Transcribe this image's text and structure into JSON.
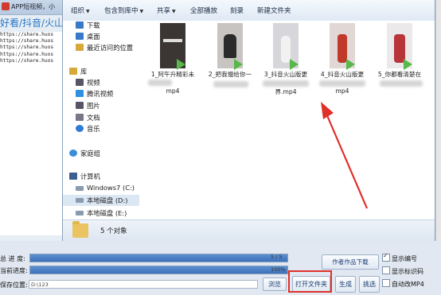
{
  "app": {
    "title": "APP短视频，小",
    "tab_label": "好看/抖音/火山",
    "urls": [
      "https://share.huos",
      "https://share.huos",
      "https://share.huos",
      "https://share.huos",
      "https://share.huos"
    ]
  },
  "explorer": {
    "toolbar": [
      {
        "label": "组织",
        "arrow": "▼"
      },
      {
        "label": "包含到库中",
        "arrow": "▼"
      },
      {
        "label": "共享",
        "arrow": "▼"
      },
      {
        "label": "全部播放",
        "arrow": ""
      },
      {
        "label": "刻录",
        "arrow": ""
      },
      {
        "label": "新建文件夹",
        "arrow": ""
      }
    ],
    "nav": [
      {
        "label": "下载",
        "icon": "download-folder-icon",
        "color": "#3a78c8"
      },
      {
        "label": "桌面",
        "icon": "desktop-icon",
        "color": "#3a78c8"
      },
      {
        "label": "最近访问的位置",
        "icon": "recent-places-icon",
        "color": "#d9a83a"
      },
      {
        "label": "库",
        "icon": "library-icon",
        "color": "#d9a83a"
      },
      {
        "label": "视频",
        "icon": "video-library-icon",
        "color": "#556"
      },
      {
        "label": "腾讯视频",
        "icon": "tencent-video-icon",
        "color": "#2f8fe0"
      },
      {
        "label": "图片",
        "icon": "pictures-library-icon",
        "color": "#556"
      },
      {
        "label": "文档",
        "icon": "documents-library-icon",
        "color": "#778"
      },
      {
        "label": "音乐",
        "icon": "music-library-icon",
        "color": "#2e7bd6"
      },
      {
        "label": "家庭组",
        "icon": "homegroup-icon",
        "color": "#3a8fd9"
      },
      {
        "label": "计算机",
        "icon": "computer-icon",
        "color": "#3b5f8f"
      },
      {
        "label": "Windows7 (C:)",
        "icon": "drive-c-icon",
        "color": "#8a9ab0"
      },
      {
        "label": "本地磁盘 (D:)",
        "icon": "drive-d-icon",
        "color": "#8a9ab0"
      },
      {
        "label": "本地磁盘 (E:)",
        "icon": "drive-e-icon",
        "color": "#8a9ab0"
      }
    ],
    "files": [
      {
        "name": "1_阿午升精彩未",
        "ext": "mp4",
        "bg": "#3b3533"
      },
      {
        "name": "2_把我慢给你一",
        "ext": "",
        "bg": "#c8c4c2"
      },
      {
        "name": "3_抖音火山版更",
        "ext": "界.mp4",
        "bg": "#d7d6db"
      },
      {
        "name": "4_抖音火山版更",
        "ext": "mp4",
        "bg": "#e1d8d5"
      },
      {
        "name": "5_你都看清楚在",
        "ext": "",
        "bg": "#ece9ea"
      }
    ],
    "status": "5 个对象"
  },
  "bottom": {
    "total_label": "总 进 度:",
    "current_label": "当前进度:",
    "save_label": "保存位置:",
    "total_progress": 1.0,
    "current_progress": 1.0,
    "total_text": "5 / 5",
    "current_text": "100%",
    "save_path": "D:\\123",
    "browse": "浏览",
    "open_folder": "打开文件夹",
    "generate": "生成",
    "pick": "挑选",
    "author_download": "作者作品下载",
    "show_number": "显示编号",
    "show_watermark": "显示标识码",
    "auto_mp4": "自动改MP4"
  }
}
